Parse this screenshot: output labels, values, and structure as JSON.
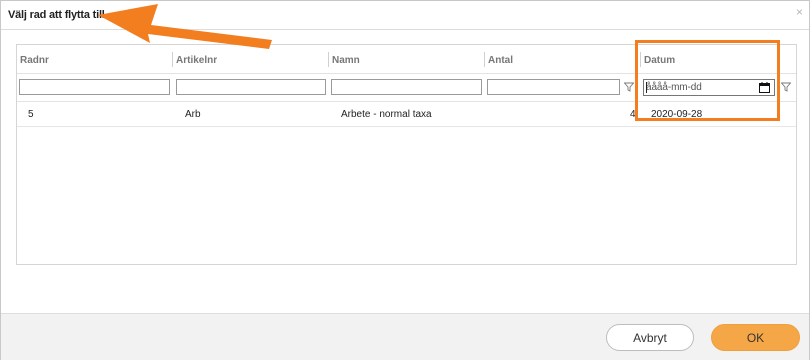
{
  "dialog": {
    "title": "Välj rad att flytta till",
    "close_symbol": "×"
  },
  "grid": {
    "columns": [
      {
        "key": "radnr",
        "label": "Radnr"
      },
      {
        "key": "artikelnr",
        "label": "Artikelnr"
      },
      {
        "key": "namn",
        "label": "Namn"
      },
      {
        "key": "antal",
        "label": "Antal"
      },
      {
        "key": "datum",
        "label": "Datum"
      }
    ],
    "filters": {
      "radnr": "",
      "artikelnr": "",
      "namn": "",
      "antal": "",
      "datum_placeholder": "åååå-mm-dd"
    },
    "rows": [
      {
        "radnr": "5",
        "artikelnr": "Arb",
        "namn": "Arbete - normal taxa",
        "antal": "4",
        "datum": "2020-09-28"
      }
    ]
  },
  "footer": {
    "cancel_label": "Avbryt",
    "ok_label": "OK"
  },
  "colors": {
    "accent_orange": "#f27e1f",
    "ok_button": "#f5a747"
  },
  "icons": [
    "close-icon",
    "filter-funnel-icon",
    "calendar-icon",
    "arrow-annotation"
  ]
}
